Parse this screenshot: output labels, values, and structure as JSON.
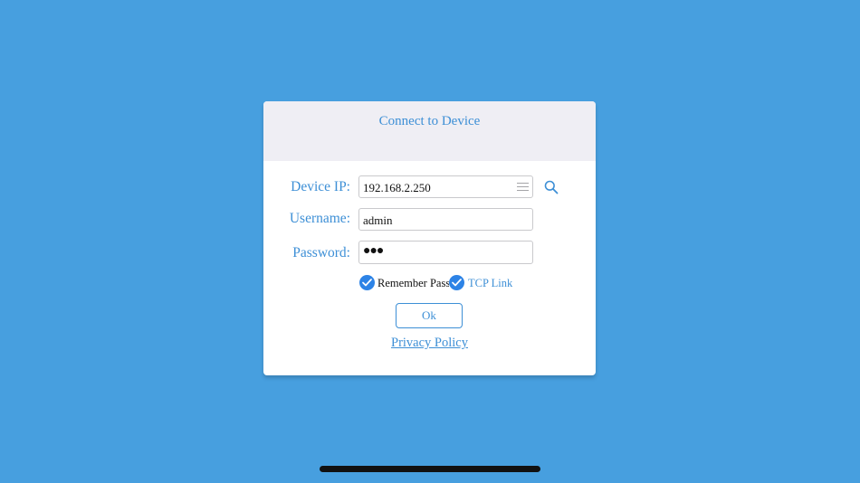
{
  "dialog": {
    "title": "Connect to Device",
    "device_ip": {
      "label": "Device IP:",
      "value": "192.168.2.250"
    },
    "username": {
      "label": "Username:",
      "value": "admin"
    },
    "password": {
      "label": "Password:",
      "masked_value": "●●●"
    },
    "remember_password": {
      "label": "Remember Password",
      "checked": true
    },
    "tcp_link": {
      "label": "TCP Link",
      "checked": true
    },
    "ok_label": "Ok",
    "privacy_label": "Privacy Policy"
  },
  "icons": {
    "history": "list-icon",
    "search": "search-icon",
    "checkbox": "checkmark-icon"
  },
  "colors": {
    "background": "#479fdf",
    "accent": "#3d8fd6",
    "checkbox": "#2d83e6",
    "header": "#efeef4"
  }
}
